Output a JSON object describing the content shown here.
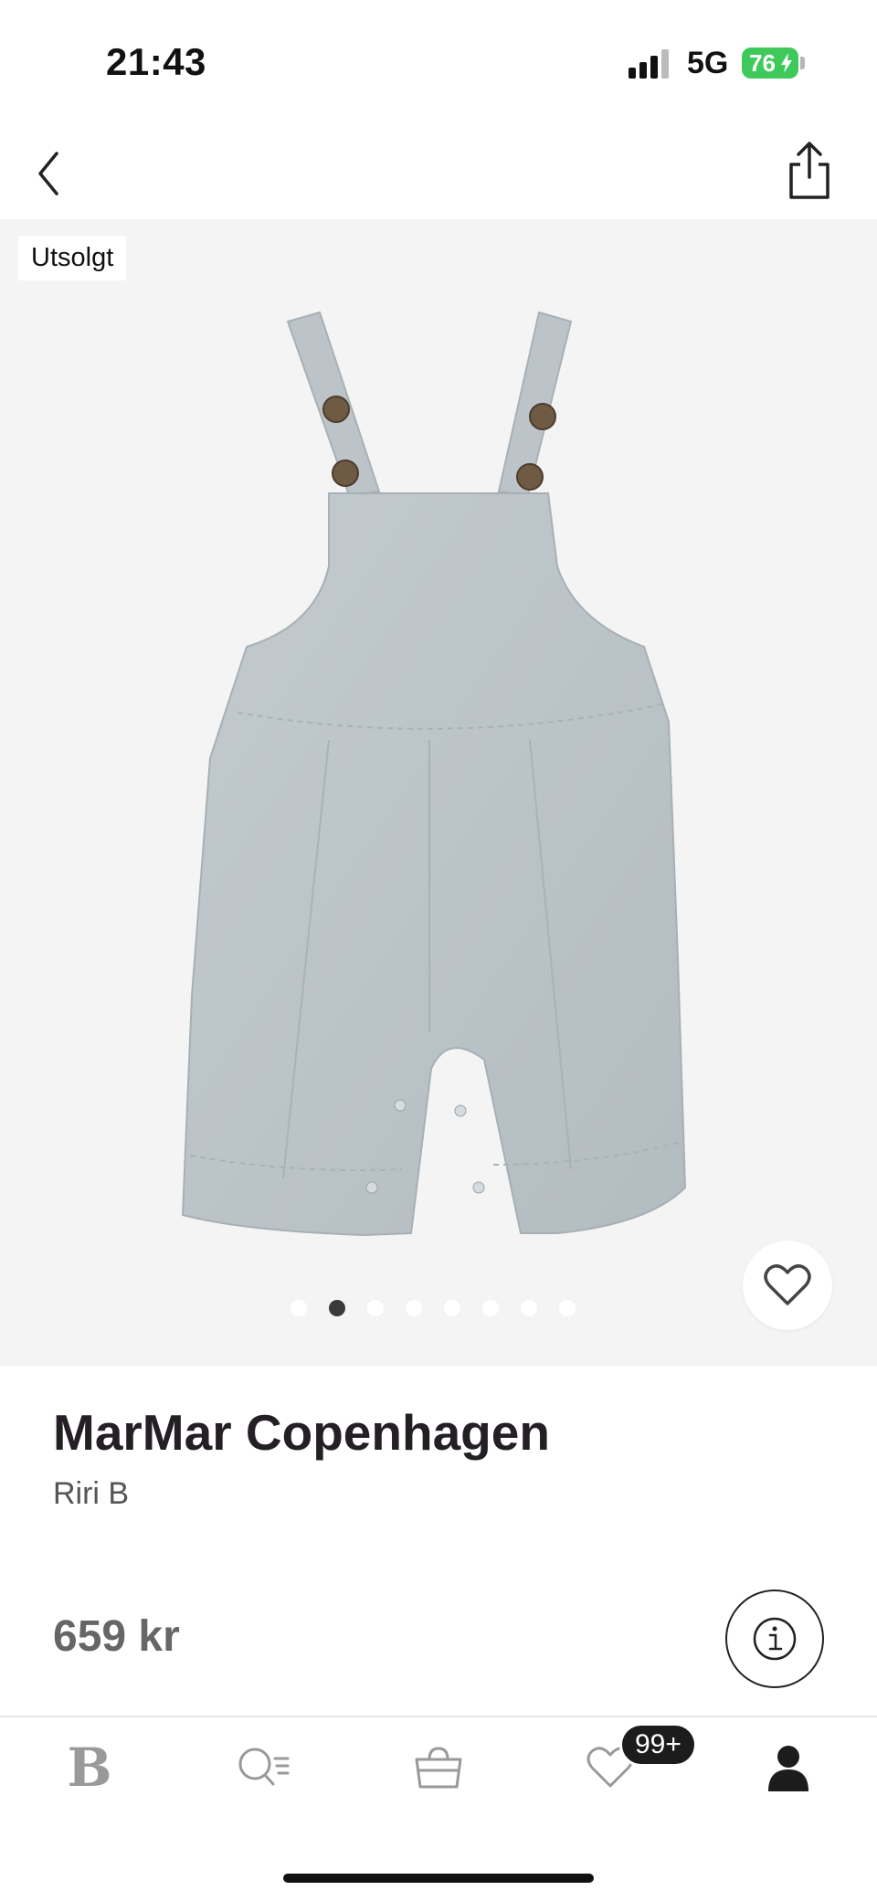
{
  "status_bar": {
    "time": "21:43",
    "network": "5G",
    "battery_level": "76",
    "battery_color": "#3ec95a"
  },
  "nav": {
    "back_icon": "chevron-left-icon",
    "share_icon": "share-icon"
  },
  "product": {
    "badge": "Utsolgt",
    "brand": "MarMar Copenhagen",
    "name": "Riri B",
    "price": "659 kr",
    "image_count": 8,
    "active_image_index": 1,
    "image_description_icon": "dungarees-image"
  },
  "tab_bar": {
    "logo": "B",
    "wishlist_badge": "99+",
    "tabs": [
      "home-logo-icon",
      "search-filter-icon",
      "shopping-bag-icon",
      "heart-icon",
      "profile-icon"
    ]
  }
}
